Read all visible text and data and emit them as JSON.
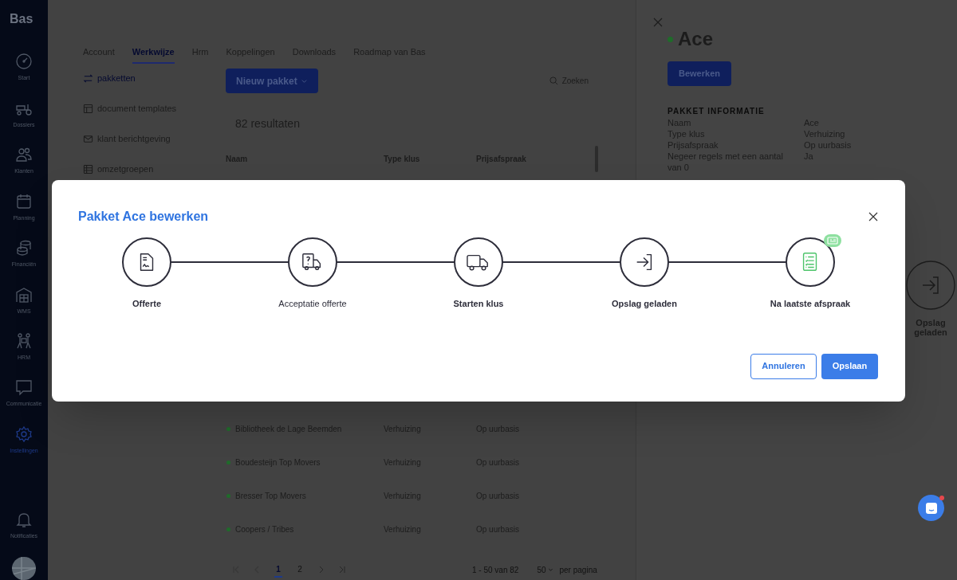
{
  "sidebar": {
    "logo": "Bas",
    "items": [
      {
        "label": "Start",
        "kind": "gauge",
        "selected": false
      },
      {
        "label": "Dossiers",
        "kind": "dossier",
        "selected": false
      },
      {
        "label": "Klanten",
        "kind": "people",
        "selected": false
      },
      {
        "label": "Planning",
        "kind": "calendar",
        "selected": false
      },
      {
        "label": "Financiën",
        "kind": "coins",
        "selected": false
      },
      {
        "label": "WMS",
        "kind": "warehouse",
        "selected": false
      },
      {
        "label": "HRM",
        "kind": "team",
        "selected": false
      },
      {
        "label": "Communicatie",
        "kind": "chat",
        "selected": false
      },
      {
        "label": "Instellingen",
        "kind": "gear",
        "selected": true
      },
      {
        "label": "Notificaties",
        "kind": "bell",
        "selected": false
      }
    ]
  },
  "tabs": [
    {
      "label": "Account",
      "selected": false
    },
    {
      "label": "Werkwijze",
      "selected": true
    },
    {
      "label": "Hrm",
      "selected": false
    },
    {
      "label": "Koppelingen",
      "selected": false
    },
    {
      "label": "Downloads",
      "selected": false
    },
    {
      "label": "Roadmap van Bas",
      "selected": false
    }
  ],
  "submenu": [
    {
      "label": "pakketten",
      "kind": "switch",
      "selected": true
    },
    {
      "label": "document templates",
      "kind": "layout",
      "selected": false
    },
    {
      "label": "klant berichtgeving",
      "kind": "mail",
      "selected": false
    },
    {
      "label": "omzetgroepen",
      "kind": "table",
      "selected": false
    }
  ],
  "toolbar": {
    "new_button": "Nieuw pakket",
    "search": "Zoeken"
  },
  "results": "82 resultaten",
  "table": {
    "columns": [
      "Naam",
      "Type klus",
      "Prijsafspraak"
    ],
    "rows": [
      {
        "cells": [
          "Bibliotheek de Lage Beemden",
          "Verhuizing",
          "Op uurbasis"
        ],
        "color": "#1f6b2a"
      },
      {
        "cells": [
          "Boudesteijn Top Movers",
          "Verhuizing",
          "Op uurbasis"
        ],
        "color": "#1f6b2a"
      },
      {
        "cells": [
          "Bresser Top Movers",
          "Verhuizing",
          "Op uurbasis"
        ],
        "color": "#1f6b2a"
      },
      {
        "cells": [
          "Coopers / Tribes",
          "Verhuizing",
          "Op uurbasis"
        ],
        "color": "#1f6b2a"
      }
    ]
  },
  "pagination": {
    "pages": [
      {
        "label": "1",
        "selected": true
      },
      {
        "label": "2",
        "selected": false
      }
    ],
    "range": "1 - 50 van 82",
    "per_page": "50",
    "per_page_label": "per pagina"
  },
  "detail": {
    "title": "Ace",
    "edit_button": "Bewerken",
    "section": "PAKKET INFORMATIE",
    "fields": [
      {
        "label": "Naam",
        "value": "Ace"
      },
      {
        "label": "Type klus",
        "value": "Verhuizing"
      },
      {
        "label": "Prijsafspraak",
        "value": "Op uurbasis"
      },
      {
        "label": "Negeer regels met een aantal van 0",
        "value": "Ja"
      }
    ],
    "background_step": "Opslag geladen"
  },
  "modal": {
    "title": "Pakket Ace bewerken",
    "steps": [
      {
        "label": "Offerte",
        "kind": "document",
        "bold": true,
        "highlighted": false
      },
      {
        "label": "Acceptatie offerte",
        "kind": "truck-question",
        "bold": false,
        "highlighted": false
      },
      {
        "label": "Starten klus",
        "kind": "truck",
        "bold": true,
        "highlighted": false
      },
      {
        "label": "Opslag geladen",
        "kind": "enter",
        "bold": true,
        "highlighted": false
      },
      {
        "label": "Na laatste afspraak",
        "kind": "checklist",
        "bold": true,
        "highlighted": true
      }
    ],
    "cancel": "Annuleren",
    "save": "Opslaan"
  }
}
